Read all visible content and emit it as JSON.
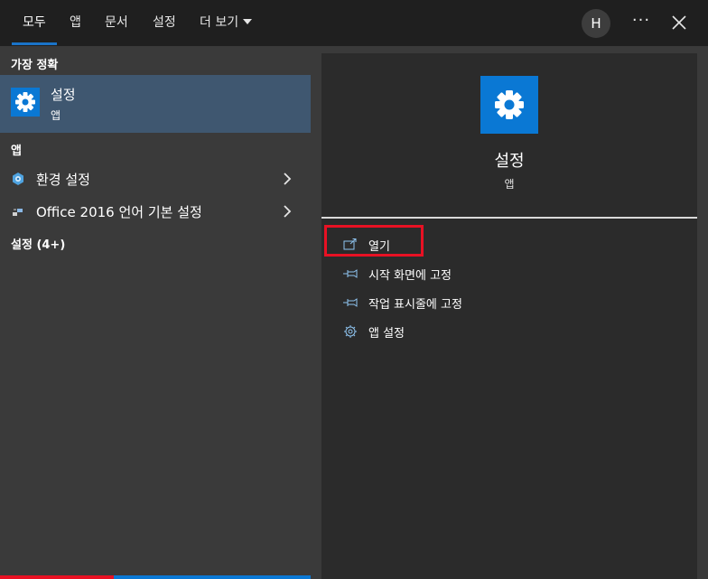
{
  "tabs": [
    {
      "label": "모두"
    },
    {
      "label": "앱"
    },
    {
      "label": "문서"
    },
    {
      "label": "설정"
    },
    {
      "label": "더 보기"
    }
  ],
  "user": {
    "initial": "H"
  },
  "more_label": "···",
  "left": {
    "best_match_header": "가장 정확",
    "best_match": {
      "title": "설정",
      "subtitle": "앱",
      "icon": "gear-icon"
    },
    "apps_header": "앱",
    "apps": [
      {
        "label": "환경 설정",
        "icon": "control-panel-icon"
      },
      {
        "label": "Office 2016 언어 기본 설정",
        "icon": "office-language-icon"
      }
    ],
    "settings_header": "설정 (4+)"
  },
  "right": {
    "title": "설정",
    "subtitle": "앱",
    "icon": "gear-icon",
    "actions": [
      {
        "label": "열기",
        "icon": "open-icon"
      },
      {
        "label": "시작 화면에 고정",
        "icon": "pin-icon"
      },
      {
        "label": "작업 표시줄에 고정",
        "icon": "pin-icon"
      },
      {
        "label": "앱 설정",
        "icon": "gear-icon"
      }
    ]
  },
  "colors": {
    "accent": "#0a78d4",
    "highlight": "#e81123",
    "selected_bg": "#3f5770"
  }
}
